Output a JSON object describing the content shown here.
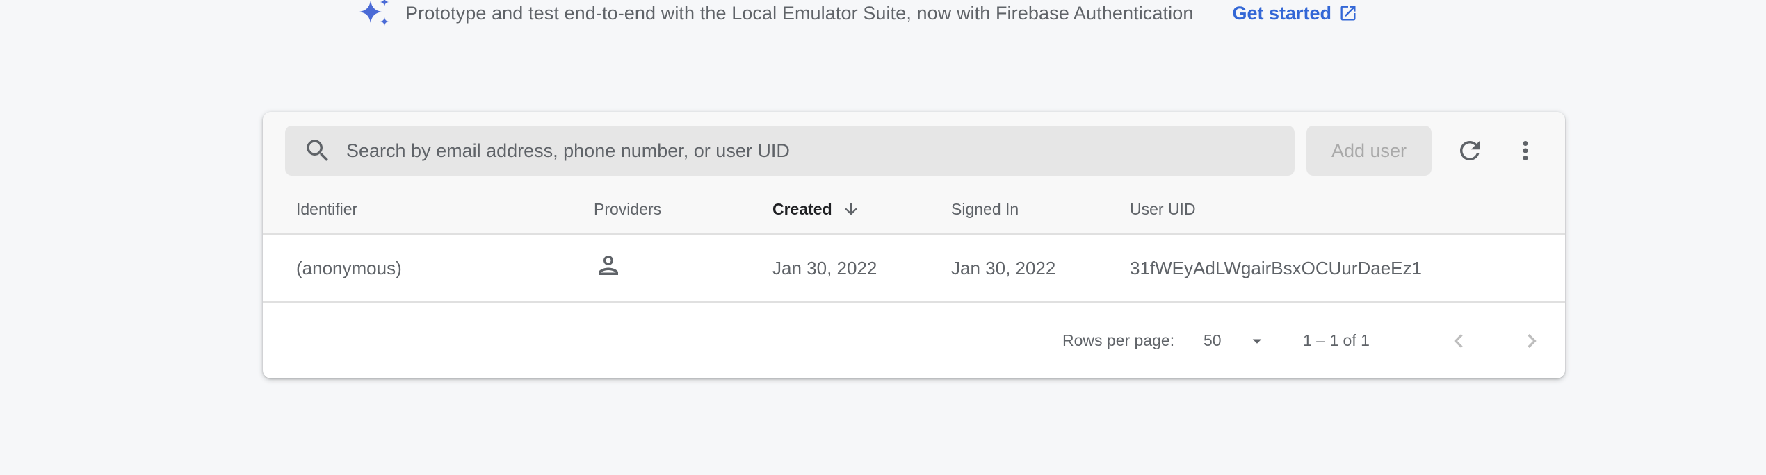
{
  "banner": {
    "text": "Prototype and test end-to-end with the Local Emulator Suite, now with Firebase Authentication",
    "cta_label": "Get started",
    "accent_color": "#3367d6",
    "sparkle_color": "#4a6ad6"
  },
  "toolbar": {
    "search_placeholder": "Search by email address, phone number, or user UID",
    "search_value": "",
    "add_user_label": "Add user",
    "refresh_icon": "refresh-icon",
    "more_icon": "more-vert-icon"
  },
  "table": {
    "columns": {
      "identifier": "Identifier",
      "providers": "Providers",
      "created": "Created",
      "signed_in": "Signed In",
      "user_uid": "User UID"
    },
    "sort": {
      "column": "Created",
      "direction": "descending"
    },
    "rows": [
      {
        "identifier": "(anonymous)",
        "provider_icon": "person-outline-icon",
        "created": "Jan 30, 2022",
        "signed_in": "Jan 30, 2022",
        "user_uid": "31fWEyAdLWgairBsxOCUurDaeEz1"
      }
    ]
  },
  "pagination": {
    "rows_per_page_label": "Rows per page:",
    "rows_per_page_value": "50",
    "range_text": "1 – 1 of 1"
  }
}
